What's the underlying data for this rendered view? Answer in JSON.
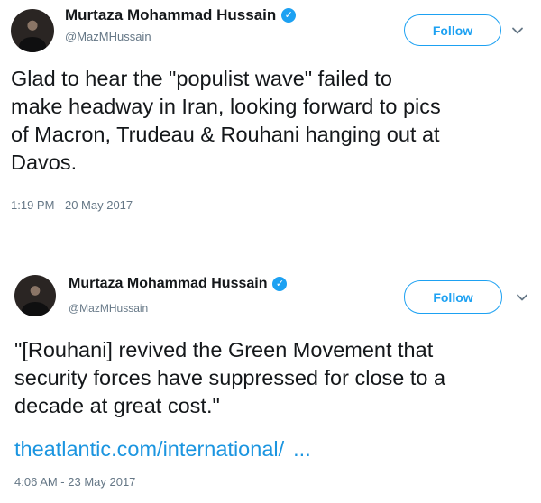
{
  "tweets": [
    {
      "author_name": "Murtaza Mohammad Hussain",
      "handle": "@MazMHussain",
      "follow_label": "Follow",
      "text": "Glad to hear the \"populist wave\" failed to\nmake headway in Iran, looking forward to pics\nof Macron, Trudeau & Rouhani hanging out at\nDavos.",
      "timestamp": "1:19 PM - 20 May 2017",
      "verified_icon": "verified-badge-icon",
      "menu_icon": "chevron-down-icon"
    },
    {
      "author_name": "Murtaza Mohammad Hussain",
      "handle": "@MazMHussain",
      "follow_label": "Follow",
      "text": "\"[Rouhani] revived the Green Movement that\nsecurity forces have suppressed for close to a\ndecade at great cost.\"",
      "link_text": "theatlantic.com/international/",
      "link_ellipsis": "...",
      "timestamp": "4:06 AM - 23 May 2017",
      "verified_icon": "verified-badge-icon",
      "menu_icon": "chevron-down-icon"
    }
  ],
  "colors": {
    "accent": "#1da1f2",
    "link": "#1b95e0",
    "text": "#14171a",
    "secondary_text": "#657786",
    "background": "#ffffff"
  }
}
